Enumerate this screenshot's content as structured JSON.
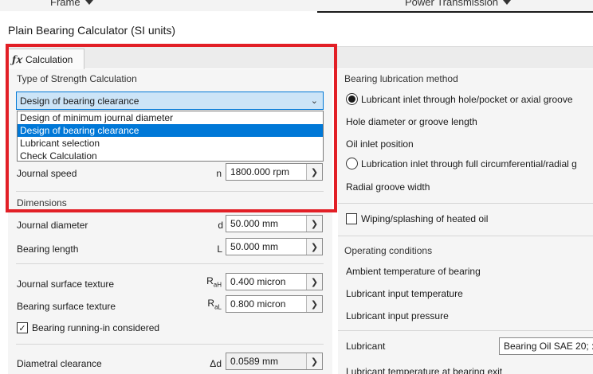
{
  "ribbon": {
    "frame_label": "Frame",
    "power_label": "Power Transmission"
  },
  "dialog": {
    "title": "Plain Bearing Calculator (SI units)"
  },
  "tabs": [
    {
      "label": "Calculation",
      "icon": "fx-icon"
    }
  ],
  "strength": {
    "section_label": "Type of Strength Calculation",
    "selected": "Design of bearing clearance",
    "options": [
      "Design of minimum journal diameter",
      "Design of bearing clearance",
      "Lubricant selection",
      "Check Calculation"
    ]
  },
  "speed": {
    "label": "Journal speed",
    "symbol": "n",
    "value": "1800.000 rpm"
  },
  "dimensions": {
    "section_label": "Dimensions",
    "journal_diameter": {
      "label": "Journal diameter",
      "symbol": "d",
      "value": "50.000 mm"
    },
    "bearing_length": {
      "label": "Bearing length",
      "symbol": "L",
      "value": "50.000 mm"
    },
    "journal_texture": {
      "label": "Journal surface texture",
      "symbol": "R",
      "sub": "aH",
      "value": "0.400 micron"
    },
    "bearing_texture": {
      "label": "Bearing surface texture",
      "symbol": "R",
      "sub": "aL",
      "value": "0.800 micron"
    },
    "runin": {
      "label": "Bearing running-in considered",
      "checked": true
    },
    "clearance": {
      "label": "Diametral clearance",
      "symbol": "Δd",
      "value": "0.0589 mm"
    }
  },
  "lubrication": {
    "section_label": "Bearing lubrication method",
    "option1": "Lubricant inlet through hole/pocket or axial groove",
    "hole_label": "Hole diameter or groove length",
    "inlet_label": "Oil inlet position",
    "option2": "Lubrication inlet through full circumferential/radial g",
    "radial_label": "Radial groove width",
    "wiping_label": "Wiping/splashing of heated oil"
  },
  "operating": {
    "section_label": "Operating conditions",
    "ambient_label": "Ambient temperature of bearing",
    "input_temp_label": "Lubricant input temperature",
    "input_pressure_label": "Lubricant input pressure",
    "lubricant_label": "Lubricant",
    "lubricant_value": "Bearing Oil SAE 20; :",
    "exit_label": "Lubricant temperature at bearing exit"
  }
}
